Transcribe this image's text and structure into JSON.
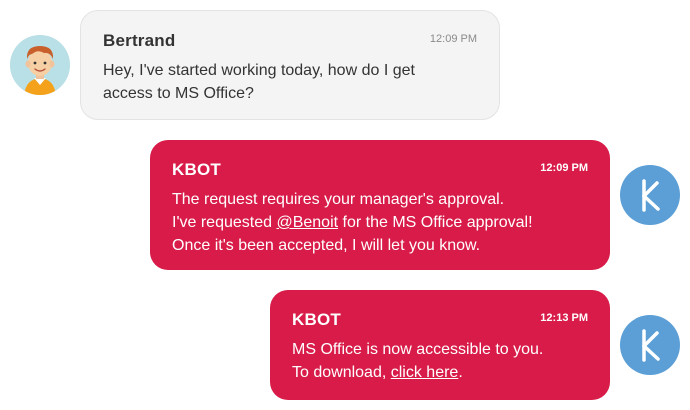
{
  "messages": [
    {
      "sender": "Bertrand",
      "time": "12:09 PM",
      "text": [
        "Hey, I've started working today, how do I get",
        "access to MS Office?"
      ]
    },
    {
      "sender": "KBOT",
      "time": "12:09 PM",
      "line1": "The request requires your manager's approval.",
      "line2_pre": "I've requested ",
      "mention": "@Benoit",
      "line2_post": " for the MS Office approval!",
      "line3": "Once it's been accepted, I will let you know."
    },
    {
      "sender": "KBOT",
      "time": "12:13 PM",
      "line1": "MS Office is now accessible to you.",
      "line2_pre": "To download, ",
      "link": "click here",
      "line2_post": "."
    }
  ],
  "colors": {
    "bot_bubble": "#d81b48",
    "bot_avatar": "#5b9fd6",
    "user_bubble": "#f4f4f4"
  },
  "icons": {
    "user_avatar": "man-avatar-icon",
    "bot_avatar": "kbot-k-logo-icon"
  }
}
